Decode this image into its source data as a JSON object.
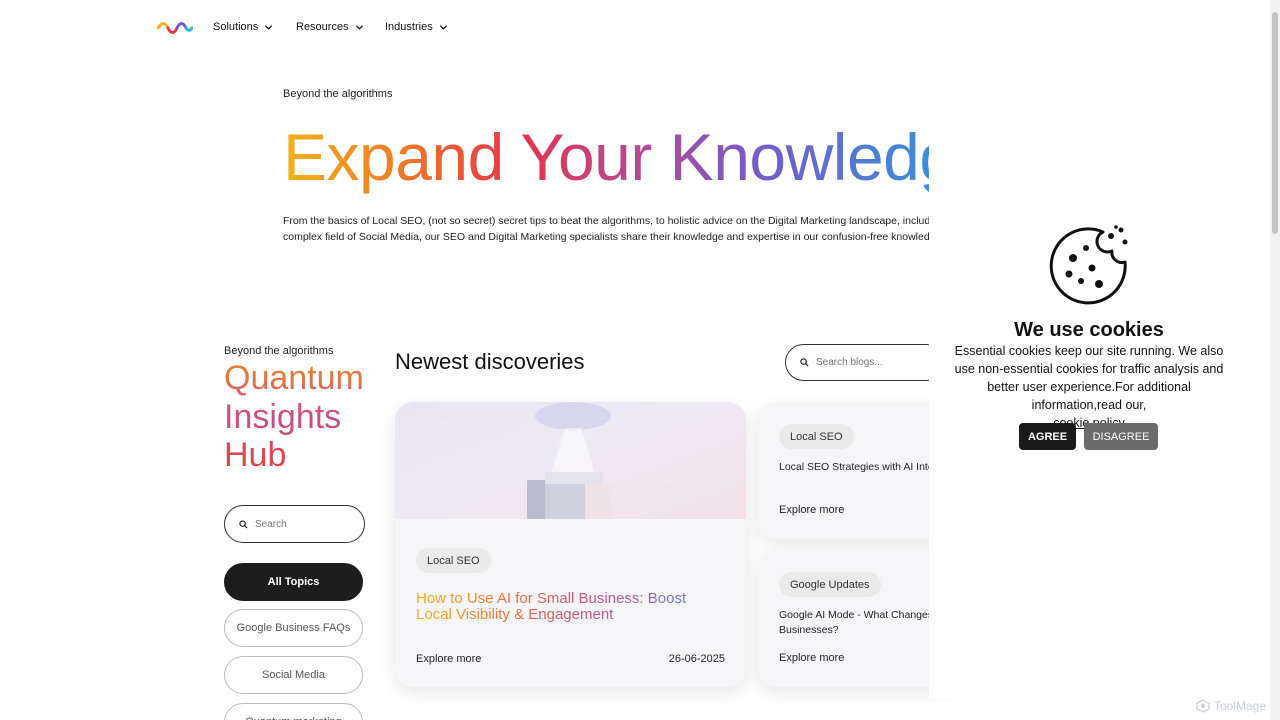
{
  "nav": {
    "items": [
      {
        "label": "Solutions"
      },
      {
        "label": "Resources"
      },
      {
        "label": "Industries"
      }
    ]
  },
  "hero": {
    "eyebrow": "Beyond the algorithms",
    "title": "Expand Your Knowledge",
    "description_line1": "From the basics of Local SEO, (not so secret) secret tips to beat the algorithms, to holistic advice on the Digital Marketing landscape, including the",
    "description_line2": "complex field of Social Media, our SEO and Digital Marketing specialists share their knowledge and expertise in our confusion-free knowledge hub."
  },
  "sidebar": {
    "eyebrow": "Beyond the algorithms",
    "title_lines": [
      "Quantum",
      "Insights",
      "Hub"
    ],
    "search_placeholder": "Search",
    "topics": [
      {
        "label": "All Topics",
        "active": true
      },
      {
        "label": "Google Business FAQs"
      },
      {
        "label": "Social Media"
      },
      {
        "label": "Quantum marketing"
      }
    ]
  },
  "main": {
    "section_title": "Newest discoveries",
    "search_placeholder": "Search blogs...",
    "featured": {
      "tag": "Local SEO",
      "title": "How to Use AI for Small Business: Boost Local Visibility & Engagement",
      "cta": "Explore more",
      "date": "26-06-2025"
    },
    "cards": [
      {
        "tag": "Local SEO",
        "title": "Local SEO Strategies with AI Integration",
        "cta": "Explore more"
      },
      {
        "tag": "Google Updates",
        "title_line1": "Google AI Mode - What Changes for",
        "title_line2": "Businesses?",
        "cta": "Explore more"
      }
    ]
  },
  "cookie": {
    "title": "We use cookies",
    "text": "Essential cookies keep our site running. We also use non-essential cookies for traffic analysis and better user experience.For additional information,read our,",
    "link": "cookie policy",
    "agree": "AGREE",
    "disagree": "DISAGREE"
  },
  "watermark": "ToolMage",
  "colors": {
    "accent_dark": "#1d1d1d",
    "gradient": [
      "#f0b21e",
      "#ee7f25",
      "#e6344c",
      "#b54a93",
      "#7a59c7",
      "#3b8ed8"
    ]
  }
}
